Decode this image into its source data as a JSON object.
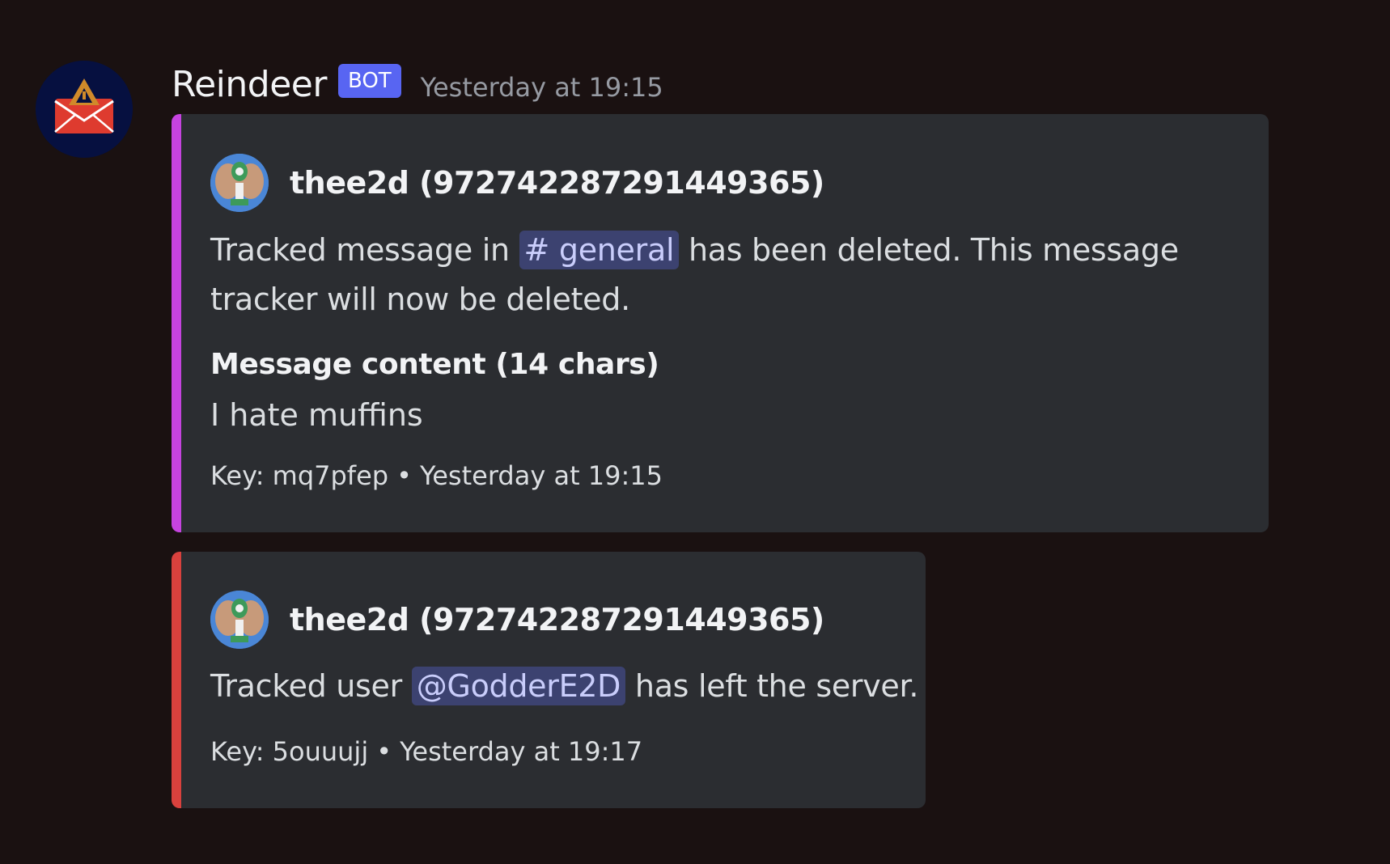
{
  "message": {
    "author": "Reindeer",
    "bot_tag": "BOT",
    "timestamp": "Yesterday at 19:15",
    "avatar_icon": "envelope-alert-icon"
  },
  "embeds": [
    {
      "accent_color": "#c643e0",
      "author_name": "thee2d (972742287291449365)",
      "description_before": "Tracked message in ",
      "channel_hash": "#",
      "channel_name": "general",
      "description_after_1": " has been deleted. This message",
      "description_line_2": "tracker will now be deleted.",
      "field_name": "Message content (14 chars)",
      "field_value": "I hate muffins",
      "footer_key": "Key: mq7pfep",
      "footer_separator": "•",
      "footer_time": "Yesterday at 19:15"
    },
    {
      "accent_color": "#d9413d",
      "author_name": "thee2d (972742287291449365)",
      "description_before": "Tracked user ",
      "user_mention": "@GodderE2D",
      "description_after": " has left the server.",
      "footer_key": "Key: 5ouuujj",
      "footer_separator": "•",
      "footer_time": "Yesterday at 19:17"
    }
  ]
}
